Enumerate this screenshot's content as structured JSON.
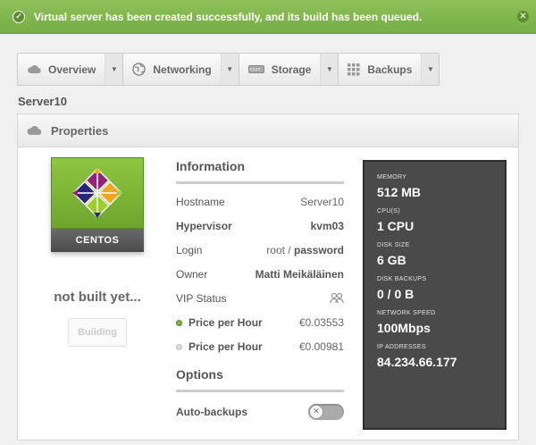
{
  "flash": {
    "message": "Virtual server has been created successfully, and its build has been queued."
  },
  "tabs": [
    {
      "label": "Overview",
      "icon": "cloud-icon"
    },
    {
      "label": "Networking",
      "icon": "globe-icon"
    },
    {
      "label": "Storage",
      "icon": "disk-icon"
    },
    {
      "label": "Backups",
      "icon": "grid-icon"
    }
  ],
  "server": {
    "name": "Server10"
  },
  "panel": {
    "title": "Properties"
  },
  "os": {
    "name": "CENTOS"
  },
  "status": {
    "text": "not built yet...",
    "button": "Building"
  },
  "information": {
    "title": "Information",
    "hostname_label": "Hostname",
    "hostname": "Server10",
    "hypervisor_label": "Hypervisor",
    "hypervisor": "kvm03",
    "login_label": "Login",
    "login_user": "root /",
    "login_pass": "password",
    "owner_label": "Owner",
    "owner": "Matti Meikäläinen",
    "vip_label": "VIP Status",
    "price_on_label": "Price per Hour",
    "price_on": "€0.03553",
    "price_off_label": "Price per Hour",
    "price_off": "€0.00981"
  },
  "options": {
    "title": "Options",
    "auto_backups_label": "Auto-backups",
    "auto_backups": false
  },
  "stats": {
    "memory_label": "MEMORY",
    "memory": "512 MB",
    "cpu_label": "CPU(S)",
    "cpu": "1 CPU",
    "disk_label": "DISK SIZE",
    "disk": "6 GB",
    "backups_label": "DISK BACKUPS",
    "backups": "0 / 0 B",
    "speed_label": "NETWORK SPEED",
    "speed": "100Mbps",
    "ip_label": "IP ADDRESSES",
    "ip": "84.234.66.177"
  },
  "colors": {
    "accent_green": "#7cb342",
    "stats_bg": "#4a4a4a"
  }
}
